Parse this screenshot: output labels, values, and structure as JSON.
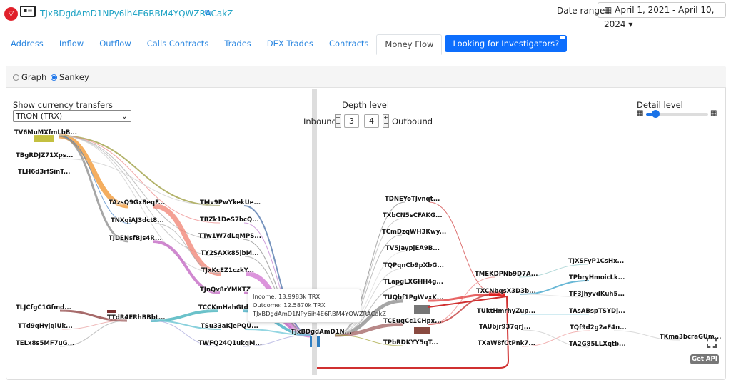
{
  "header": {
    "address": "TJxBDgdAmD1NPy6ih4E6RBM4YQWZRACakZ",
    "date_range_label": "Date range",
    "date_range_value": "April 1, 2021 - April 10, 2024"
  },
  "tabs": [
    {
      "label": "Address"
    },
    {
      "label": "Inflow"
    },
    {
      "label": "Outflow"
    },
    {
      "label": "Calls Contracts"
    },
    {
      "label": "Trades"
    },
    {
      "label": "DEX Trades"
    },
    {
      "label": "Contracts"
    },
    {
      "label": "Money Flow",
      "active": true
    }
  ],
  "investigators_button": "Looking for Investigators?",
  "view": {
    "graph": "Graph",
    "sankey": "Sankey",
    "selected": "Sankey"
  },
  "controls": {
    "currency_label": "Show currency transfers",
    "currency_value": "TRON (TRX)",
    "depth_label": "Depth level",
    "inbound": "Inbound",
    "outbound": "Outbound",
    "inbound_depth": "3",
    "outbound_depth": "4",
    "plus": "+",
    "minus": "−",
    "detail_label": "Detail level",
    "detail_level": 0.1
  },
  "nodes": [
    "TV6MuMXfmLbB...",
    "TBgRDJZ71Xps...",
    "TLH6d3rfSinT...",
    "TAzsQ9Gx8eqF...",
    "TNXqiAJ3dct8...",
    "TJDENsfBJs4R...",
    "TMv9PwYkekUe...",
    "TBZk1DeS7bcQ...",
    "TTw1W7dLqMPS...",
    "TY2SAXk85jbM...",
    "TJxKcEZ1czkY...",
    "TJnQv8rYMKTZ...",
    "TLJCfgC1Gfmd...",
    "TTd9qHyjqiUk...",
    "TELx8s5MF7uG...",
    "TTdR4ERhBBbt...",
    "TCCKmHahGtdQ...",
    "TSu33aKjePQU...",
    "TWFQ24Q1ukqM...",
    "TJxBDgdAmD1N...",
    "TDNEYoTJvnqt...",
    "TXbCN5sCFAKG...",
    "TCmDzqWH3Kwy...",
    "TV5JaypjEA9B...",
    "TQPqnCb9pXbG...",
    "TLapgLXGHH4g...",
    "TUQbf1PgWvxK...",
    "TCEuqCc1CHpx...",
    "TPbRDKYY5qT...",
    "TMEKDPNb9D7A...",
    "TXCNbqsX3D3b...",
    "TUktHmrhyZup...",
    "TAUbjr937qrJ...",
    "TXaW8fCtPnk7...",
    "TJXSFyP1CsHx...",
    "TPbryHmoicLk...",
    "TF3JhyvdKuh5...",
    "TAsABspTSYDj...",
    "TQf9d2g2aF4n...",
    "TA2G85LLXqtb...",
    "TKma3bcraGUm..."
  ],
  "tooltip": {
    "income": "Income: 13.9983k TRX",
    "outcome": "Outcome: 12.5870k TRX",
    "address": "TJxBDgdAmD1NPy6ih4E6RBM4YQWZRACakZ"
  },
  "get_api": "Get API",
  "colors": {
    "accent": "#0d6efd",
    "link": "#2a86e0",
    "center_node": "#2f7fc1"
  }
}
